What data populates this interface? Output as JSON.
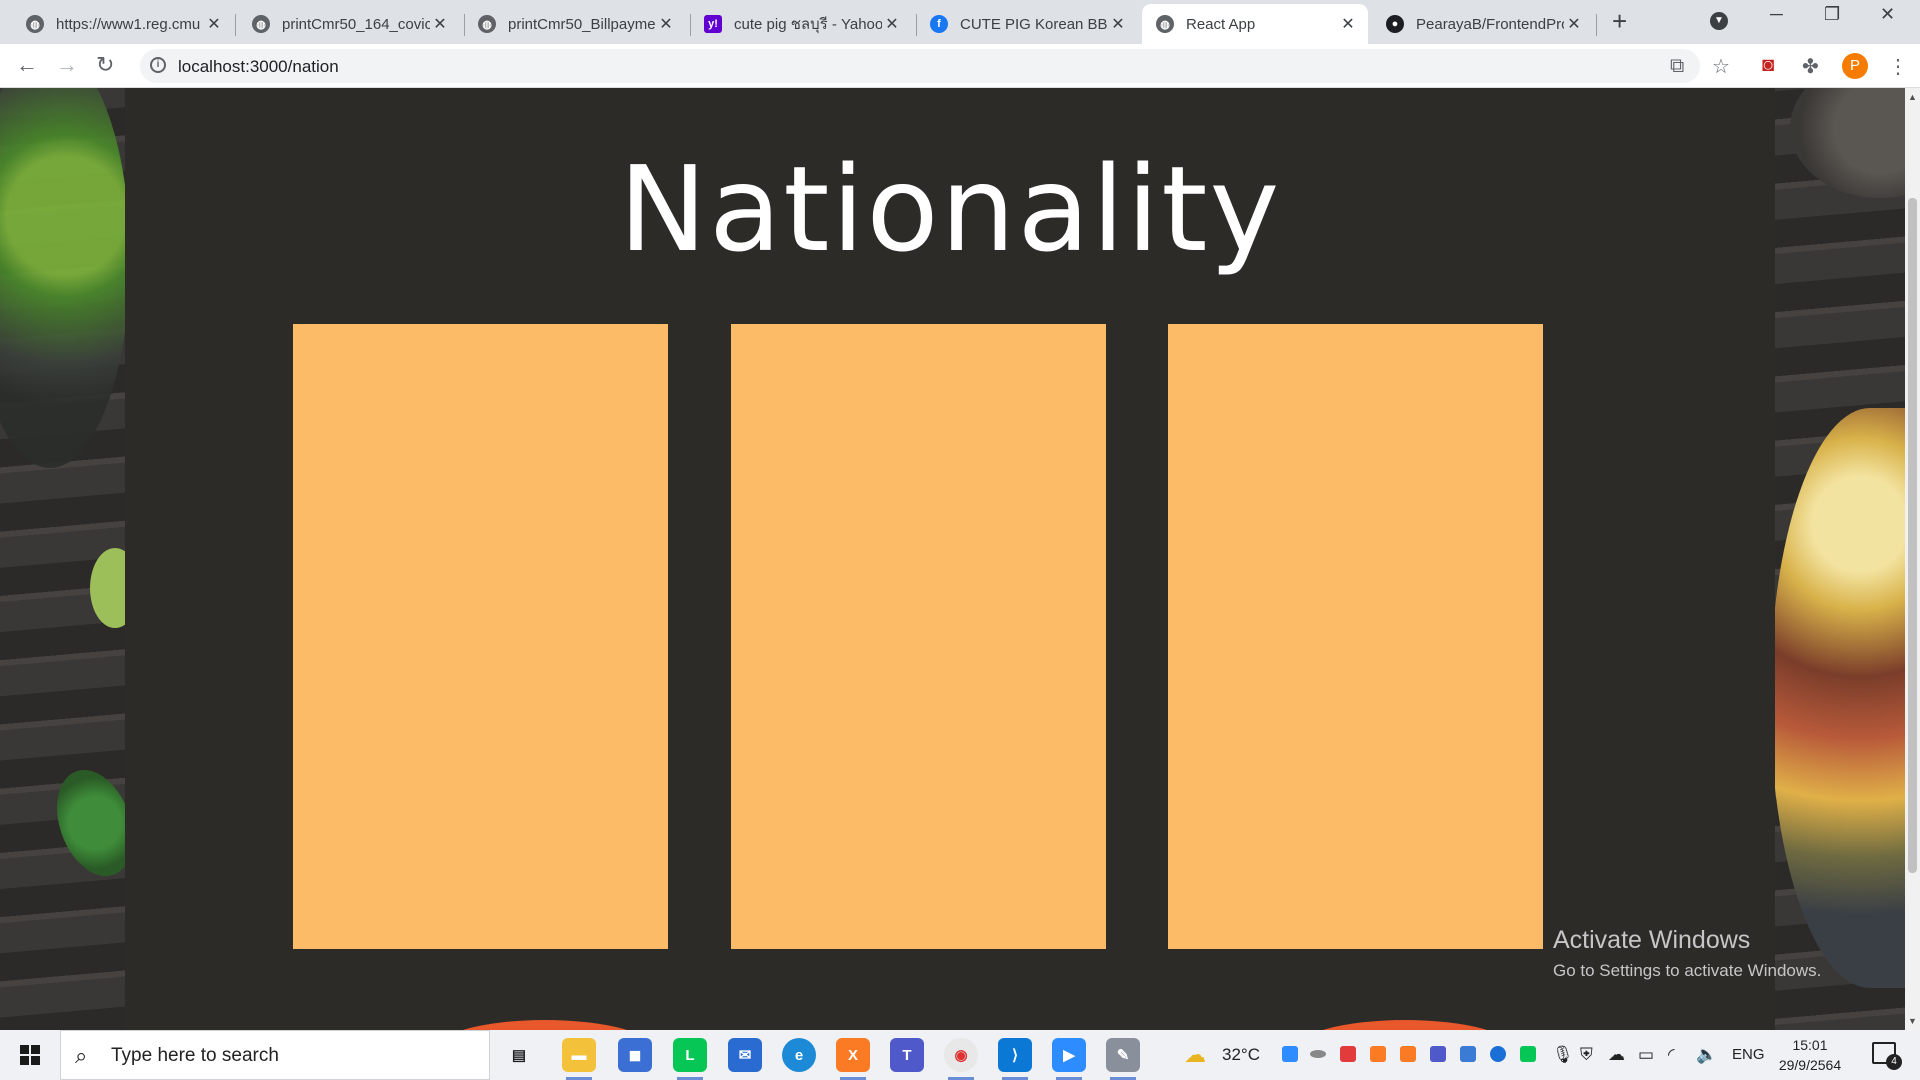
{
  "browser": {
    "tabs": [
      {
        "label": "https://www1.reg.cmu",
        "favicon": "globe-icon",
        "active": false
      },
      {
        "label": "printCmr50_164_covic",
        "favicon": "globe-icon",
        "active": false
      },
      {
        "label": "printCmr50_Billpayme",
        "favicon": "globe-icon",
        "active": false
      },
      {
        "label": "cute pig ชลบุรี - Yahoo",
        "favicon": "yahoo-icon",
        "active": false
      },
      {
        "label": "CUTE PIG Korean BBQ",
        "favicon": "facebook-icon",
        "active": false
      },
      {
        "label": "React App",
        "favicon": "globe-icon",
        "active": true
      },
      {
        "label": "PearayaB/FrontendPro",
        "favicon": "github-icon",
        "active": false
      }
    ],
    "url": "localhost:3000/nation",
    "profile_initial": "P"
  },
  "page": {
    "heading": "Nationality",
    "cards": 3,
    "card_color": "#fbbb67",
    "background_color": "#2d2b28"
  },
  "watermark": {
    "title": "Activate Windows",
    "subtitle": "Go to Settings to activate Windows."
  },
  "taskbar": {
    "search_placeholder": "Type here to search",
    "weather": "32°C",
    "language": "ENG",
    "time": "15:01",
    "date": "29/9/2564",
    "notification_count": "4"
  }
}
